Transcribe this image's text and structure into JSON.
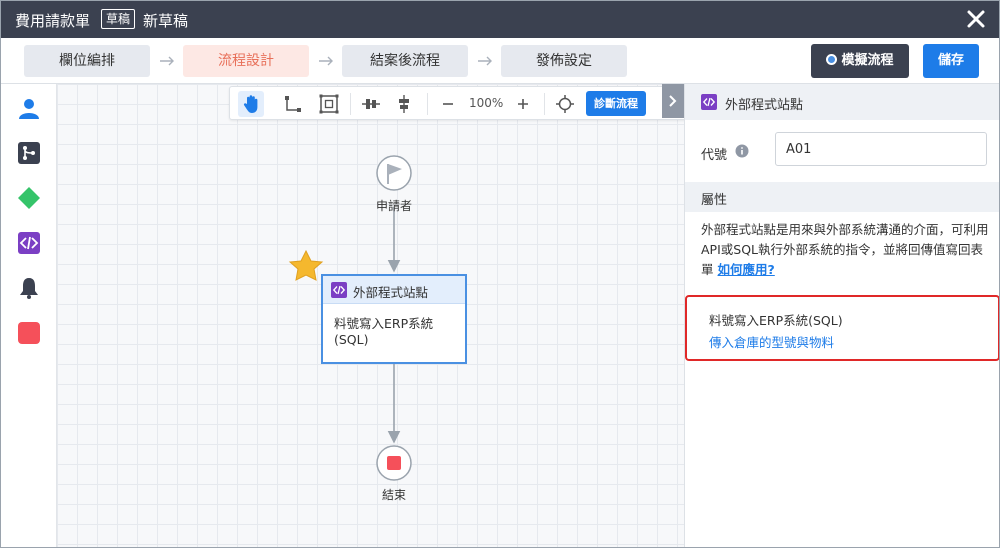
{
  "titlebar": {
    "form_name": "費用請款單",
    "status_tag": "草稿",
    "draft_name": "新草稿"
  },
  "steps": [
    {
      "label": "欄位編排"
    },
    {
      "label": "流程設計",
      "active": true
    },
    {
      "label": "結案後流程"
    },
    {
      "label": "發佈設定"
    }
  ],
  "actions": {
    "simulate_label": "模擬流程",
    "save_label": "儲存"
  },
  "canvas_toolbar": {
    "zoom": "100%",
    "diagnose_label": "診斷流程"
  },
  "flow": {
    "start_label": "申請者",
    "node_title": "外部程式站點",
    "node_body": "料號寫入ERP系統(SQL)",
    "end_label": "結束"
  },
  "panel": {
    "title": "外部程式站點",
    "code_label": "代號",
    "code_value": "A01",
    "section_title": "屬性",
    "description": "外部程式站點是用來與外部系統溝通的介面，可利用API或SQL執行外部系統的指令，並將回傳值寫回表單",
    "help_link": "如何應用?",
    "ext_name": "料號寫入ERP系統(SQL)",
    "ext_desc": "傳入倉庫的型號與物料"
  },
  "colors": {
    "titlebar_bg": "#3b4150",
    "accent_blue": "#1e7ce8",
    "active_step": "#e8705a",
    "highlight_red": "#e02828",
    "star": "#f5b82e"
  }
}
